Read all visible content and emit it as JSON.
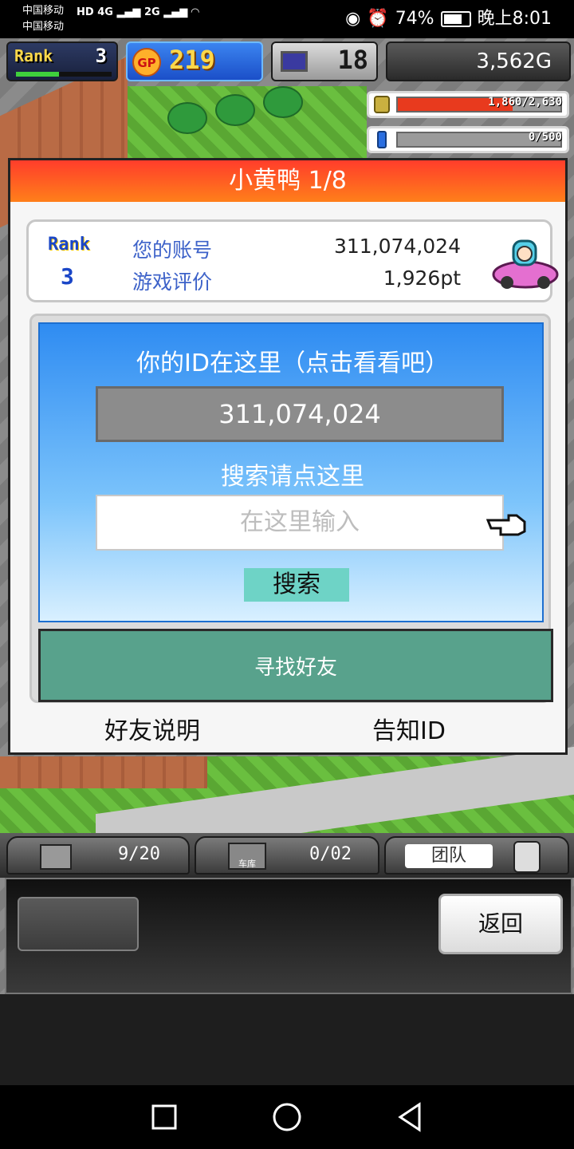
{
  "status_bar": {
    "carrier1": "中国移动",
    "carrier2": "中国移动",
    "battery": "74%",
    "time": "晚上8:01"
  },
  "hud": {
    "rank_label": "Rank",
    "rank_value": "3",
    "rank_progress": 0.45,
    "gp_label": "GP",
    "gp_value": "219",
    "pc_value": "18",
    "money": "3,562G",
    "resource1": "1,860/2,630",
    "resource1_fraction": 0.707,
    "resource2": "0/500",
    "resource2_fraction": 0.0
  },
  "dialog": {
    "title": "小黄鸭 1/8",
    "rank_label": "Rank",
    "rank_value": "3",
    "account_label": "您的账号",
    "account_value": "311,074,024",
    "rating_label": "游戏评价",
    "rating_value": "1,926pt",
    "id_prompt": "你的ID在这里（点击看看吧）",
    "id_value": "311,074,024",
    "search_prompt": "搜索请点这里",
    "search_placeholder": "在这里输入",
    "search_button": "搜索",
    "find_friend": "寻找好友",
    "friend_help": "好友说明",
    "tell_id": "告知ID"
  },
  "tabs": {
    "tab1_count": "9/20",
    "tab2_label": "车库",
    "tab2_count": "0/02",
    "tab3_label": "团队"
  },
  "bottom": {
    "back": "返回"
  }
}
